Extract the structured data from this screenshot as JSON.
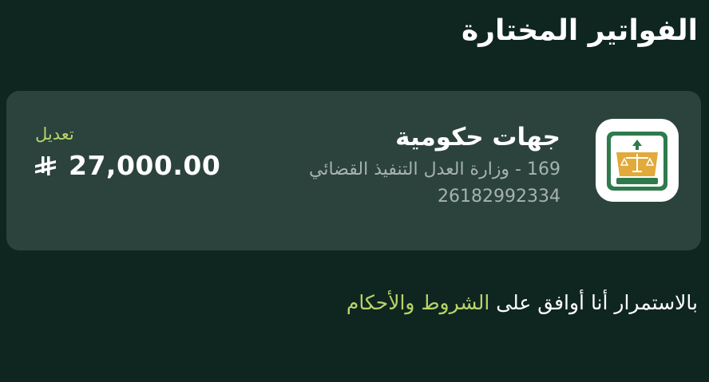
{
  "header": {
    "title": "الفواتير المختارة"
  },
  "bill": {
    "category": "جهات حكومية",
    "provider": "169 - وزارة العدل التنفيذ القضائي",
    "number": "26182992334",
    "edit_label": "تعديل",
    "amount": "27,000.00",
    "logo_icon": "ministry-of-justice-logo-icon",
    "currency_icon": "saudi-riyal-icon"
  },
  "terms": {
    "prefix": "بالاستمرار أنا أوافق على",
    "link_label": "الشروط والأحكام"
  },
  "colors": {
    "background": "#0f2620",
    "card": "#2b433c",
    "accent": "#b9d36a",
    "muted_text": "#a7b2ae"
  }
}
